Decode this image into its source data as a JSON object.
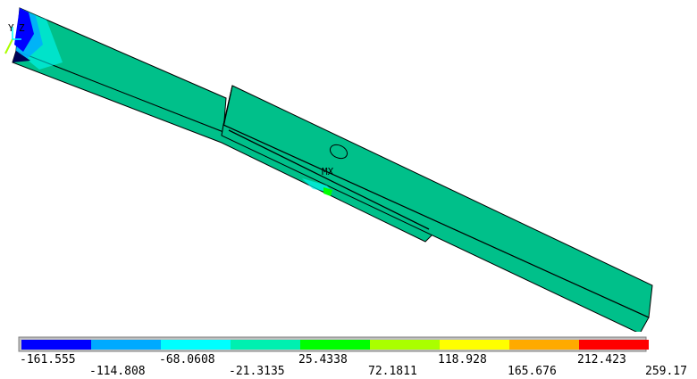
{
  "viewport": {
    "triad_labels": [
      "Y",
      "Z"
    ],
    "max_label": "MX"
  },
  "legend": {
    "colors": [
      "#0000ff",
      "#00aaff",
      "#00ffff",
      "#00f0b0",
      "#00ff00",
      "#aaff00",
      "#ffff00",
      "#ffaa00",
      "#ff0000"
    ],
    "ticks": [
      "-161.555",
      "-114.808",
      "-68.0608",
      "-21.3135",
      "25.4338",
      "72.1811",
      "118.928",
      "165.676",
      "212.423",
      "259.17"
    ],
    "model_color": "#00c08a",
    "edge_color": "#000000"
  }
}
